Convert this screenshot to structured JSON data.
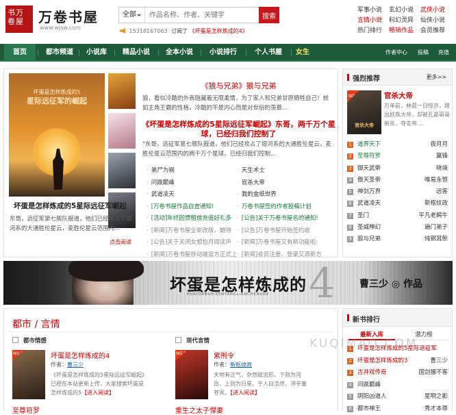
{
  "logo": {
    "seal": "书万 卷屋",
    "name": "万卷书屋",
    "url": "www.wjsw.com"
  },
  "search": {
    "category": "全部",
    "placeholder": "作品名称、作者、关键字",
    "button": "搜索"
  },
  "notice": {
    "phone": "15318167063",
    "action": "订阅了",
    "book": "《坏蛋是怎样炼成的4》"
  },
  "quicklinks": [
    {
      "label": "军事小说",
      "color": "#333333"
    },
    {
      "label": "玄幻小说",
      "color": "#333333"
    },
    {
      "label": "武侠小说",
      "color": "#cc0000"
    },
    {
      "label": "言情小说",
      "color": "#cc0000"
    },
    {
      "label": "科幻灵异",
      "color": "#333333"
    },
    {
      "label": "仙侠小说",
      "color": "#333333"
    },
    {
      "label": "热门排行",
      "color": "#333333"
    },
    {
      "label": "畅销作品",
      "color": "#cc0000"
    },
    {
      "label": "会员推荐",
      "color": "#333333"
    }
  ],
  "nav": {
    "items": [
      "首页",
      "都市频道",
      "小说库",
      "精品小说",
      "全本小说",
      "小说排行",
      "个人书屋",
      "女生"
    ],
    "right": [
      "作者中心",
      "投稿",
      "充值"
    ]
  },
  "featured": {
    "cover_sub": "坏蛋是怎样炼成的5",
    "cover_title": "星际远征军的崛起",
    "title": "坏蛋是怎样炼成的5星际远征军崛起",
    "desc": "东哥，远征军第七舰队报道，他们已经攻占了银河系的大通胜伦星云，麦胜伦星云范围内...",
    "more": "点击阅读",
    "headline1": "《狼与兄弟》狼与兄弟",
    "para1": "狼，看似冷酷的外表隐藏着无限柔情，为了家人和兄弟甘愿牺牲自己！就如主角王霸的性格，冷酷的不是内心而是对世俗的羡慕...",
    "headline2": "《坏蛋是怎样炼成的5星际远征军崛起》东哥，两千万个星球，已经归我们控制了",
    "para2": "\"东哥，远征军第七舰队报道，他们已经攻占了银河系的大通胜伦星云，麦胜伦星云范围内的两千万个星球，已经归我们控制...",
    "list_left": [
      "弟尸为祸",
      "问鼎巅峰",
      "武道凌天",
      "[万卷书屋作品自查通知!",
      "[活动]年终回馈租借充值好礼多",
      "[新闻]万卷书屋全新改版，期待",
      "[公告]关于关闭女频包月阅读声",
      "[新闻]万卷书屋移动端官方正式上"
    ],
    "list_right": [
      "天生术士",
      "官杀大帝",
      "我的金纸世界",
      "万卷书屋签约作者投稿计划",
      "[公告]关于万卷书屋名的通知!",
      "[公告]万卷书屋开始签约收",
      "[新闻]万卷书屋又有新功能啦:",
      "[新闻]会员注册、登录又添新方"
    ]
  },
  "recommend": {
    "title": "强烈推荐",
    "more": "更多>>",
    "top": {
      "title": "官杀大帝",
      "cover_text": "官杀大帝",
      "badge": "NO.1",
      "desc": "万年前，林孤一日惊亦，踏出妖族大帝，却被孔弟哥哥新杀，夺走帝...."
    },
    "rows": [
      {
        "book": "道界天下",
        "author": "夜月月",
        "color": "#117a3c"
      },
      {
        "book": "至尊符罗",
        "author": "赢锋",
        "color": "#117a3c"
      },
      {
        "book": "御天武帝",
        "author": "晓境",
        "color": "#333333"
      },
      {
        "book": "傲天圣帝",
        "author": "唯易永恒",
        "color": "#333333"
      },
      {
        "book": "神剑万界",
        "author": "远客",
        "color": "#333333"
      },
      {
        "book": "武道凌天",
        "author": "新枢纹政",
        "color": "#333333"
      },
      {
        "book": "圣门",
        "author": "平凡老鳄牛",
        "color": "#333333"
      },
      {
        "book": "圣威神幻",
        "author": "遍门弟子",
        "color": "#333333"
      },
      {
        "book": "狼与兄弟",
        "author": "纯钢耳鬃",
        "color": "#333333"
      }
    ]
  },
  "banner": {
    "title": "坏蛋是怎样炼成的",
    "number": "4",
    "pinyin": "HUAIDANSHIZENYANGLIANCHENGDE",
    "author": "曹三少 ◎ 作品"
  },
  "city": {
    "heading": "都市 / 言情",
    "col1": {
      "category": "都市情感",
      "badge": "NO.1",
      "title": "坏蛋是怎样炼成的4",
      "author_label": "作者：",
      "author": "曹三少",
      "desc": "《坏蛋是怎样炼成的5星际远征军崛起》已经在本站更新上传，大家搜索坏蛋是怎样炼成的5",
      "link": "【进入阅读】",
      "bottom": "至尊符罗"
    },
    "col2": {
      "category": "现代言情",
      "badge": "NO.1",
      "title": "紫刑令",
      "author_label": "作者：",
      "author": "新枢纹政",
      "desc": "天地有正气，杂然赋流形。下则为河岳，上则为日星。于人曰浩然，沛乎塞苍冥。",
      "link": "【进入阅读】",
      "bottom": "重生之太子悍妻"
    }
  },
  "rank": {
    "title": "新书排行",
    "tabs": [
      "最新入库",
      "潜力榜"
    ],
    "rows": [
      {
        "book": "坏蛋是怎样炼成的5星际远征军",
        "author": "",
        "color": "#c00000"
      },
      {
        "book": "坏蛋是怎样炼成的3",
        "author": "曹三少",
        "color": "#c00000"
      },
      {
        "book": "古井戏传奇",
        "author": "国剑擂不客",
        "color": "#c00000"
      },
      {
        "book": "问鼎巅峰",
        "author": "",
        "color": "#333333"
      },
      {
        "book": "阴阳凶道人",
        "author": "星明之影",
        "color": "#333333"
      },
      {
        "book": "都市神王",
        "author": "秀才本尊",
        "color": "#333333"
      }
    ]
  },
  "watermark": "KUQIMAO.COM"
}
